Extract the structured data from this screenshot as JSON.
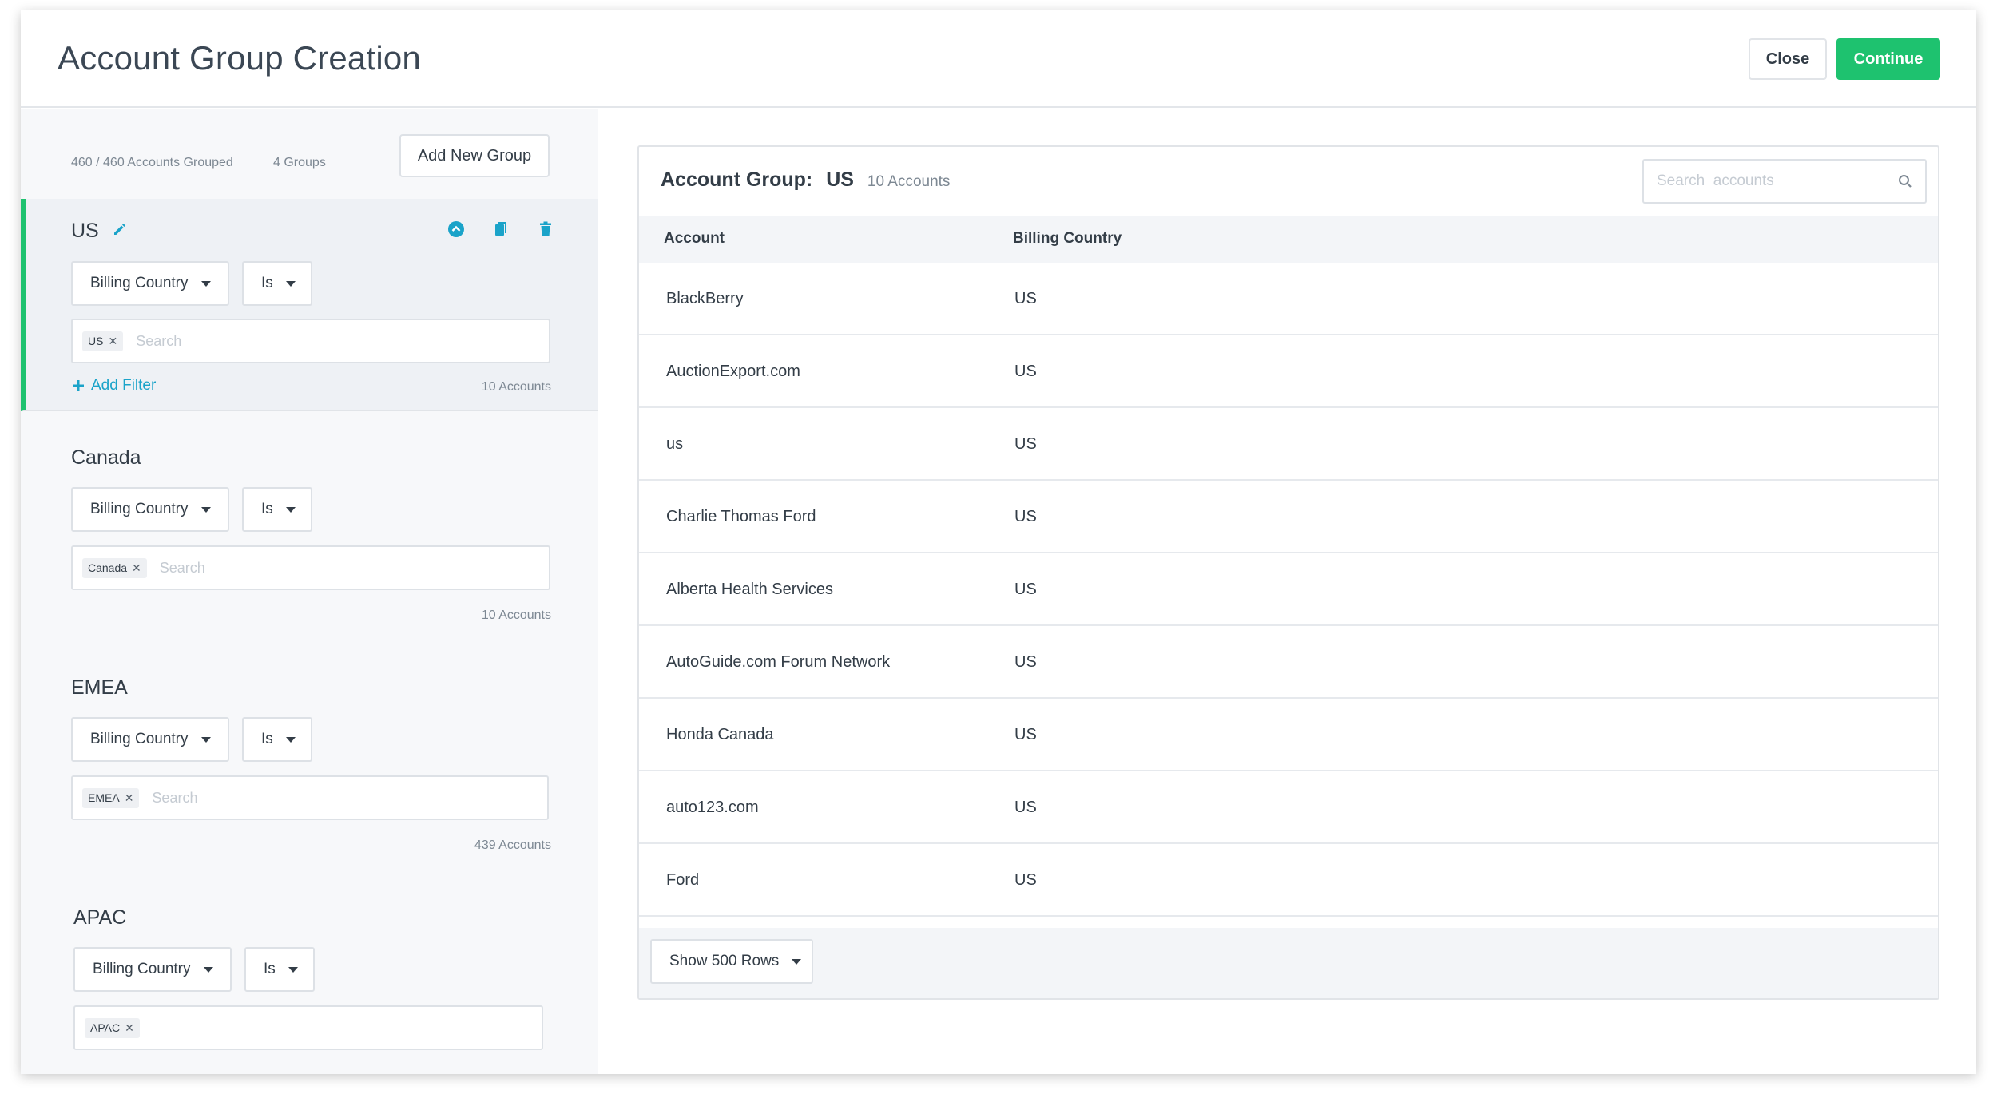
{
  "header": {
    "title": "Account Group Creation",
    "close_label": "Close",
    "continue_label": "Continue"
  },
  "left": {
    "accounts_grouped": "460 / 460 Accounts Grouped",
    "groups_count": "4 Groups",
    "add_group_label": "Add New Group",
    "groups": [
      {
        "name": "US",
        "field": "Billing Country",
        "operator": "Is",
        "tag": "US",
        "placeholder": "Search",
        "add_filter": "Add Filter",
        "count": "10 Accounts",
        "active": true
      },
      {
        "name": "Canada",
        "field": "Billing Country",
        "operator": "Is",
        "tag": "Canada",
        "placeholder": "Search",
        "count": "10 Accounts"
      },
      {
        "name": "EMEA",
        "field": "Billing Country",
        "operator": "Is",
        "tag": "EMEA",
        "placeholder": "Search",
        "count": "439 Accounts"
      },
      {
        "name": "APAC",
        "field": "Billing Country",
        "operator": "Is",
        "tag": "APAC"
      }
    ]
  },
  "panel": {
    "title_prefix": "Account Group:",
    "group_name": "US",
    "count": "10 Accounts",
    "search_placeholder": "Search  accounts",
    "columns": [
      "Account",
      "Billing Country"
    ],
    "rows": [
      [
        "BlackBerry",
        "US"
      ],
      [
        "AuctionExport.com",
        "US"
      ],
      [
        "us",
        "US"
      ],
      [
        "Charlie Thomas Ford",
        "US"
      ],
      [
        "Alberta Health Services",
        "US"
      ],
      [
        "AutoGuide.com Forum Network",
        "US"
      ],
      [
        "Honda Canada",
        "US"
      ],
      [
        "auto123.com",
        "US"
      ],
      [
        "Ford",
        "US"
      ]
    ],
    "rows_label": "Show 500 Rows"
  },
  "colors": {
    "accent_green": "#1ec26f",
    "link_blue": "#1aa3c9",
    "text_dark": "#333d47"
  }
}
